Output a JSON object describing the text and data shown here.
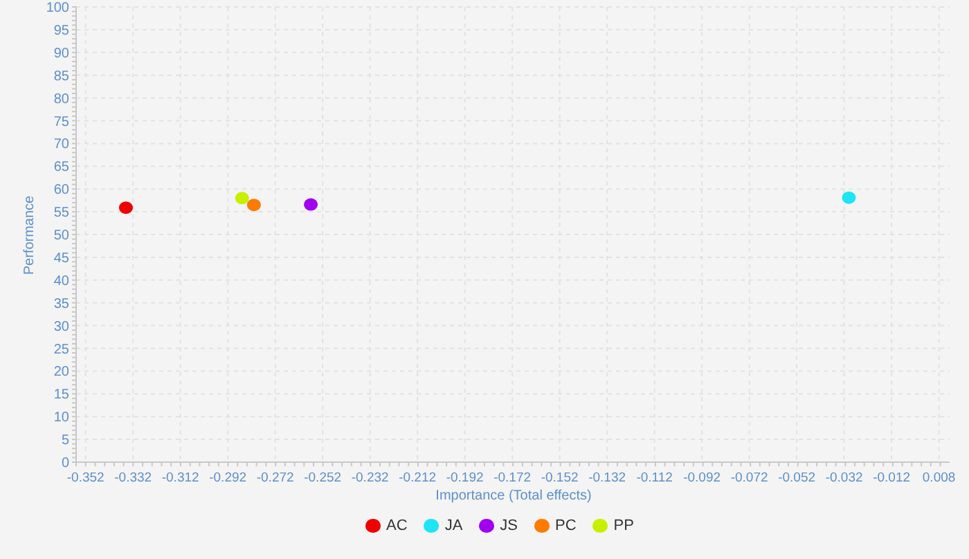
{
  "chart_data": {
    "type": "scatter",
    "grid": true,
    "xlabel": "Importance (Total effects)",
    "ylabel": "Performance",
    "xlim": [
      -0.356,
      0.0125
    ],
    "ylim": [
      0,
      100
    ],
    "xticks": [
      -0.352,
      -0.332,
      -0.312,
      -0.292,
      -0.272,
      -0.252,
      -0.232,
      -0.212,
      -0.192,
      -0.172,
      -0.152,
      -0.132,
      -0.112,
      -0.092,
      -0.072,
      -0.052,
      -0.032,
      -0.012,
      0.008
    ],
    "yticks": [
      0,
      5,
      10,
      15,
      20,
      25,
      30,
      35,
      40,
      45,
      50,
      55,
      60,
      65,
      70,
      75,
      80,
      85,
      90,
      95,
      100
    ],
    "series": [
      {
        "name": "AC",
        "color": "#f00000",
        "x": [
          -0.335
        ],
        "values": [
          55.9
        ]
      },
      {
        "name": "JA",
        "color": "#1ee4f5",
        "x": [
          -0.03
        ],
        "values": [
          58.1
        ]
      },
      {
        "name": "JS",
        "color": "#a100ef",
        "x": [
          -0.257
        ],
        "values": [
          56.6
        ]
      },
      {
        "name": "PC",
        "color": "#ff7a00",
        "x": [
          -0.281
        ],
        "values": [
          56.5
        ]
      },
      {
        "name": "PP",
        "color": "#c6f000",
        "x": [
          -0.286
        ],
        "values": [
          58.0
        ]
      }
    ]
  }
}
